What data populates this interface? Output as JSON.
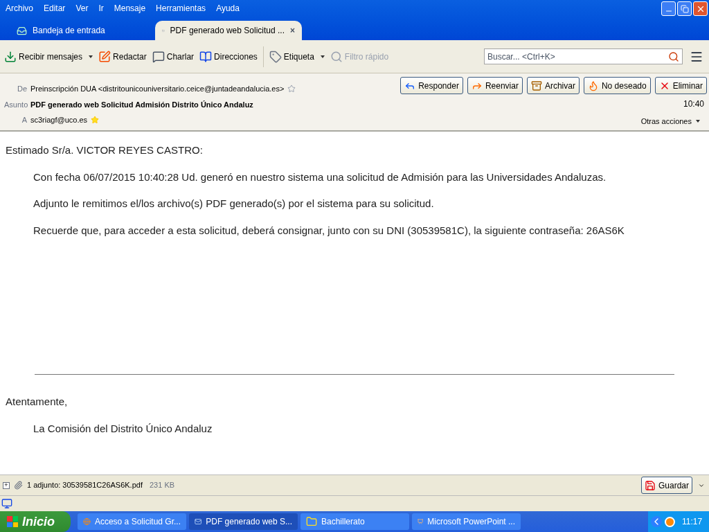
{
  "menu": [
    "Archivo",
    "Editar",
    "Ver",
    "Ir",
    "Mensaje",
    "Herramientas",
    "Ayuda"
  ],
  "tabs": [
    {
      "label": "Bandeja de entrada",
      "kind": "inbox",
      "selected": false
    },
    {
      "label": "PDF generado web Solicitud ...",
      "kind": "message",
      "selected": true,
      "close": "×"
    }
  ],
  "toolbar": [
    {
      "label": "Recibir mensajes",
      "kind": "receive",
      "dropdown": true,
      "disabled": false
    },
    {
      "label": "Redactar",
      "kind": "compose",
      "dropdown": false,
      "disabled": false
    },
    {
      "label": "Charlar",
      "kind": "chat",
      "dropdown": false,
      "disabled": false
    },
    {
      "label": "Direcciones",
      "kind": "book",
      "dropdown": false,
      "disabled": false
    },
    {
      "label": "Etiqueta",
      "kind": "tag",
      "dropdown": true,
      "disabled": false
    },
    {
      "label": "Filtro rápido",
      "kind": "filter",
      "dropdown": false,
      "disabled": true
    }
  ],
  "search": {
    "placeholder": "Buscar... <Ctrl+K>"
  },
  "header": {
    "from_label": "De",
    "from": "Preinscripción DUA <distritounicouniversitario.ceice@juntadeandalucia.es>",
    "subject_label": "Asunto",
    "subject": "PDF generado web Solicitud Admisión Distrito Único Andaluz",
    "to_label": "A",
    "to": "sc3riagf@uco.es",
    "time": "10:40",
    "more": "Otras acciones",
    "actions": [
      {
        "label": "Responder",
        "kind": "reply"
      },
      {
        "label": "Reenviar",
        "kind": "forward"
      },
      {
        "label": "Archivar",
        "kind": "archive"
      },
      {
        "label": "No deseado",
        "kind": "junk"
      },
      {
        "label": "Eliminar",
        "kind": "delete"
      }
    ]
  },
  "body": {
    "greeting": "Estimado Sr/a. VICTOR REYES CASTRO:",
    "paragraphs": [
      "Con fecha 06/07/2015 10:40:28 Ud. generó en nuestro sistema una solicitud de Admisión para las Universidades Andaluzas.",
      "Adjunto le remitimos el/los archivo(s) PDF generado(s) por el sistema para su solicitud.",
      "Recuerde que, para acceder a esta solicitud, deberá consignar, junto con su DNI (30539581C), la siguiente contraseña: 26AS6K"
    ],
    "closing": "Atentamente,",
    "signature": "La Comisión del Distrito Único Andaluz"
  },
  "attachment": {
    "expand": "+",
    "label": "1 adjunto: 30539581C26AS6K.pdf",
    "size": "231 KB",
    "save": "Guardar"
  },
  "taskbar": {
    "start": "Inicio",
    "clock": "11:17",
    "items": [
      {
        "label": "Acceso a Solicitud Gr...",
        "kind": "firefox",
        "selected": false
      },
      {
        "label": "PDF generado web S...",
        "kind": "mail",
        "selected": true
      },
      {
        "label": "Bachillerato",
        "kind": "folder",
        "selected": false
      },
      {
        "label": "Microsoft PowerPoint ...",
        "kind": "ppt",
        "selected": false
      }
    ]
  }
}
